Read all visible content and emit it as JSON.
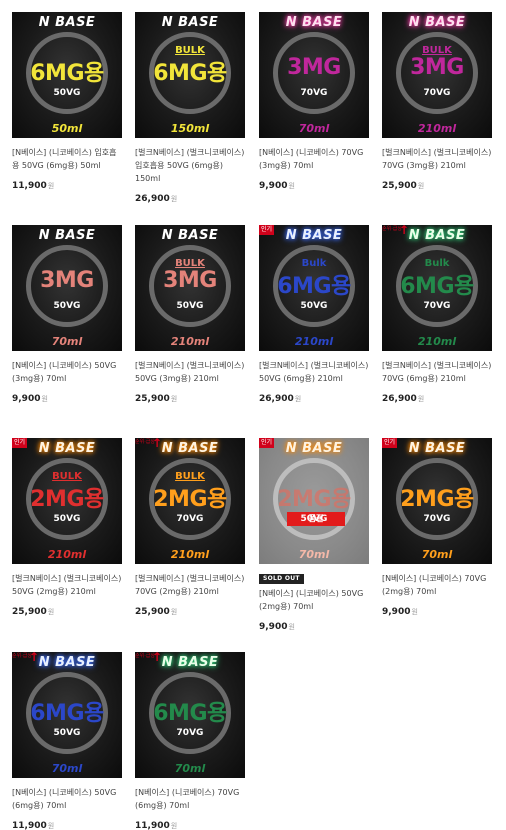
{
  "colors": {
    "yellow": "#f2e53a",
    "magenta": "#c0279c",
    "salmon": "#e4837a",
    "blue": "#2b47c9",
    "green": "#238a4b",
    "red": "#e02f2f",
    "orange": "#ff9f1c",
    "hot_badge": "#d0021b",
    "soldout_tag": "#222222"
  },
  "badges": {
    "hot": "인기",
    "rank": "순위·급상",
    "stamp": "품절",
    "soldout": "SOLD OUT"
  },
  "products": [
    {
      "brand": "N BASE",
      "bulk": "",
      "mg": "6MG용",
      "vg": "50VG",
      "ml": "50ml",
      "title": "[N베이스] (니코베이스) 입호흡용 50VG (6mg용) 50ml",
      "price": "11,900",
      "currency": "원"
    },
    {
      "brand": "N BASE",
      "bulk": "BULK",
      "mg": "6MG용",
      "vg": "",
      "ml": "150ml",
      "title": "[벌크N베이스] (벌크니코베이스) 입호흡용 50VG (6mg용) 150ml",
      "price": "26,900",
      "currency": "원"
    },
    {
      "brand": "N BASE",
      "bulk": "",
      "mg": "3MG",
      "vg": "70VG",
      "ml": "70ml",
      "title": "[N베이스] (니코베이스) 70VG (3mg용) 70ml",
      "price": "9,900",
      "currency": "원"
    },
    {
      "brand": "N BASE",
      "bulk": "BULK",
      "mg": "3MG",
      "vg": "70VG",
      "ml": "210ml",
      "title": "[벌크N베이스] (벌크니코베이스) 70VG (3mg용) 210ml",
      "price": "25,900",
      "currency": "원"
    },
    {
      "brand": "N BASE",
      "bulk": "",
      "mg": "3MG",
      "vg": "50VG",
      "ml": "70ml",
      "title": "[N베이스] (니코베이스) 50VG (3mg용) 70ml",
      "price": "9,900",
      "currency": "원"
    },
    {
      "brand": "N BASE",
      "bulk": "BULK",
      "mg": "3MG",
      "vg": "50VG",
      "ml": "210ml",
      "title": "[벌크N베이스] (벌크니코베이스) 50VG (3mg용) 210ml",
      "price": "25,900",
      "currency": "원"
    },
    {
      "brand": "N BASE",
      "bulk": "Bulk",
      "mg": "6MG용",
      "vg": "50VG",
      "ml": "210ml",
      "title": "[벌크N베이스] (벌크니코베이스) 50VG (6mg용) 210ml",
      "price": "26,900",
      "currency": "원"
    },
    {
      "brand": "N BASE",
      "bulk": "Bulk",
      "mg": "6MG용",
      "vg": "70VG",
      "ml": "210ml",
      "title": "[벌크N베이스] (벌크니코베이스) 70VG (6mg용) 210ml",
      "price": "26,900",
      "currency": "원"
    },
    {
      "brand": "N BASE",
      "bulk": "BULK",
      "mg": "2MG용",
      "vg": "50VG",
      "ml": "210ml",
      "title": "[벌크N베이스] (벌크니코베이스) 50VG (2mg용) 210ml",
      "price": "25,900",
      "currency": "원"
    },
    {
      "brand": "N BASE",
      "bulk": "BULK",
      "mg": "2MG용",
      "vg": "70VG",
      "ml": "210ml",
      "title": "[벌크N베이스] (벌크니코베이스) 70VG (2mg용) 210ml",
      "price": "25,900",
      "currency": "원"
    },
    {
      "brand": "N BASE",
      "bulk": "",
      "mg": "2MG용",
      "vg": "50VG",
      "ml": "70ml",
      "title": "[N베이스] (니코베이스) 50VG (2mg용) 70ml",
      "price": "9,900",
      "currency": "원"
    },
    {
      "brand": "N BASE",
      "bulk": "",
      "mg": "2MG용",
      "vg": "70VG",
      "ml": "70ml",
      "title": "[N베이스] (니코베이스) 70VG (2mg용) 70ml",
      "price": "9,900",
      "currency": "원"
    },
    {
      "brand": "N BASE",
      "bulk": "",
      "mg": "6MG용",
      "vg": "50VG",
      "ml": "70ml",
      "title": "[N베이스] (니코베이스) 50VG (6mg용) 70ml",
      "price": "11,900",
      "currency": "원"
    },
    {
      "brand": "N BASE",
      "bulk": "",
      "mg": "6MG용",
      "vg": "70VG",
      "ml": "70ml",
      "title": "[N베이스] (니코베이스) 70VG (6mg용) 70ml",
      "price": "11,900",
      "currency": "원"
    }
  ]
}
